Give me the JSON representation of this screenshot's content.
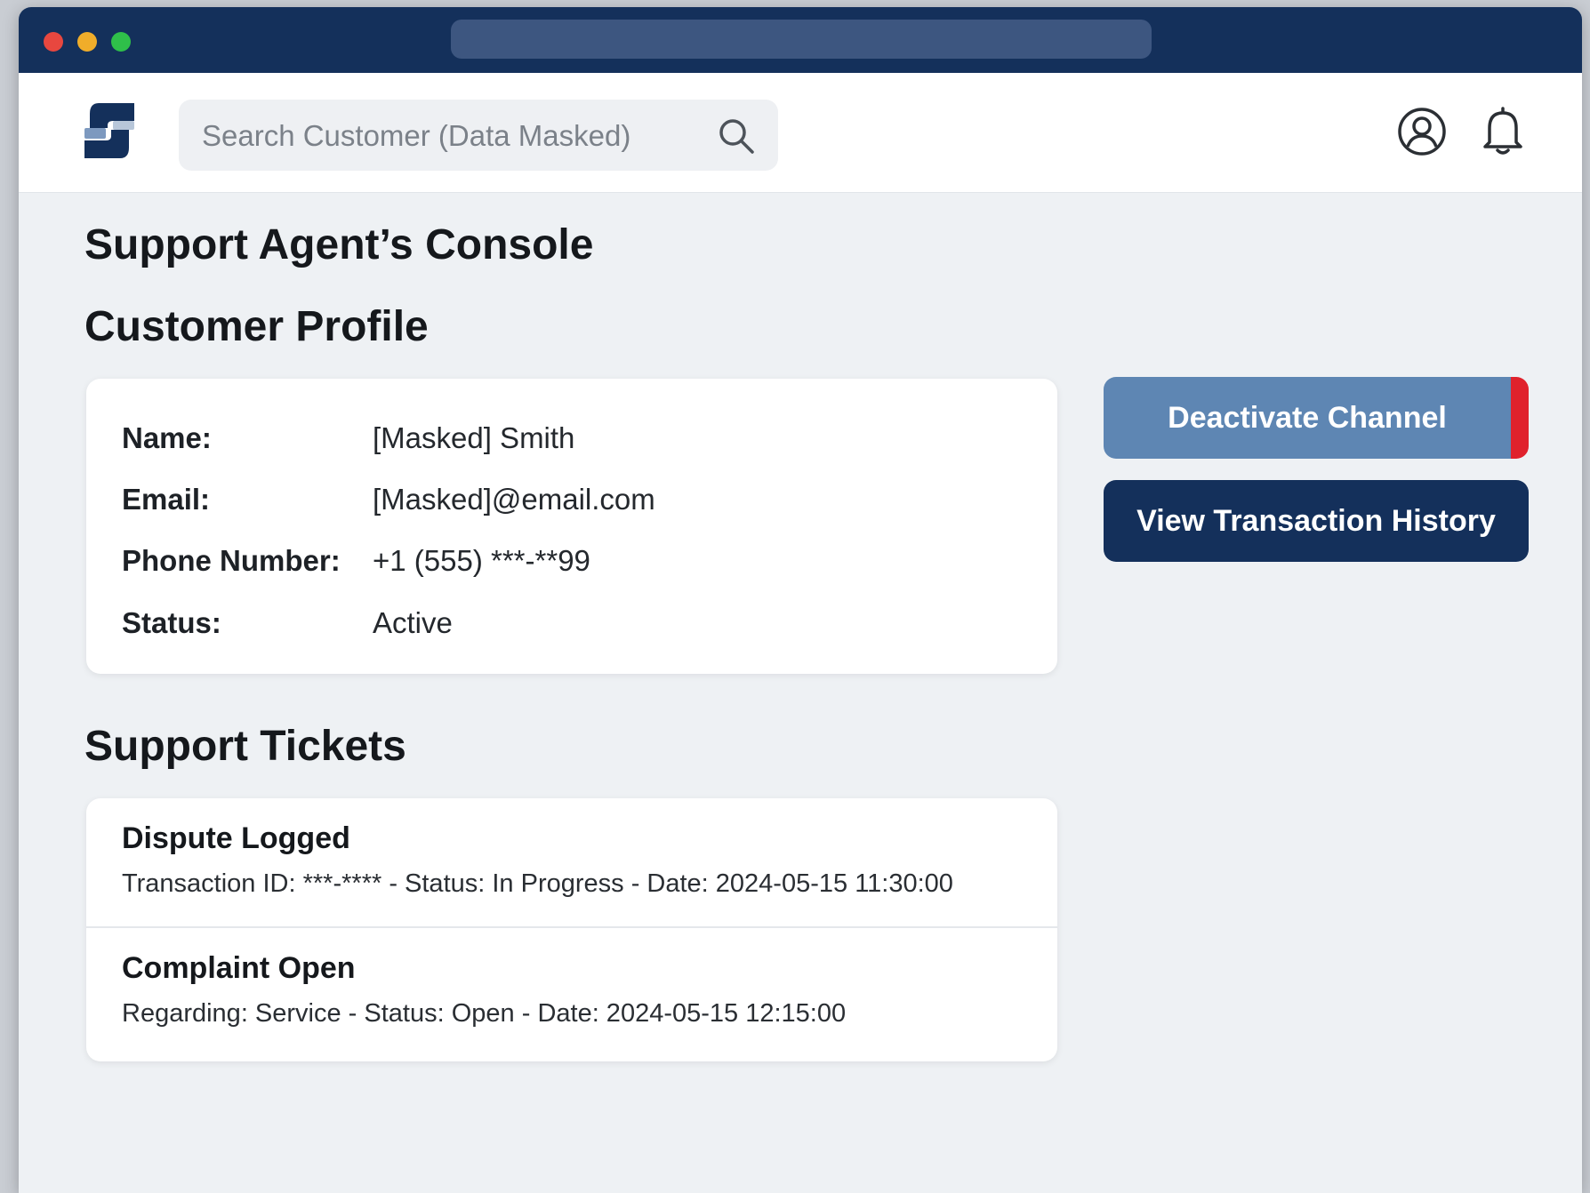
{
  "header": {
    "search_placeholder": "Search Customer (Data Masked)",
    "logo_icon": "brand-s-logo",
    "user_icon": "user-circle-icon",
    "notification_icon": "bell-icon"
  },
  "page": {
    "title": "Support Agent’s Console"
  },
  "profile": {
    "section_title": "Customer Profile",
    "fields": [
      {
        "label": "Name:",
        "value": "[Masked] Smith"
      },
      {
        "label": "Email:",
        "value": "[Masked]@email.com"
      },
      {
        "label": "Phone Number:",
        "value": "+1 (555) ***-**99"
      },
      {
        "label": "Status:",
        "value": "Active"
      }
    ]
  },
  "actions": {
    "deactivate_label": "Deactivate Channel",
    "history_label": "View Transaction History"
  },
  "tickets": {
    "section_title": "Support Tickets",
    "items": [
      {
        "title": "Dispute Logged",
        "detail": "Transaction ID: ***-**** - Status: In Progress - Date: 2024-05-15 11:30:00"
      },
      {
        "title": "Complaint Open",
        "detail": "Regarding: Service - Status: Open - Date: 2024-05-15 12:15:00"
      }
    ]
  },
  "colors": {
    "titlebar": "#14305b",
    "primary_button": "#14305b",
    "deactivate_button": "#5e86b3",
    "danger_accent": "#e0222c"
  }
}
